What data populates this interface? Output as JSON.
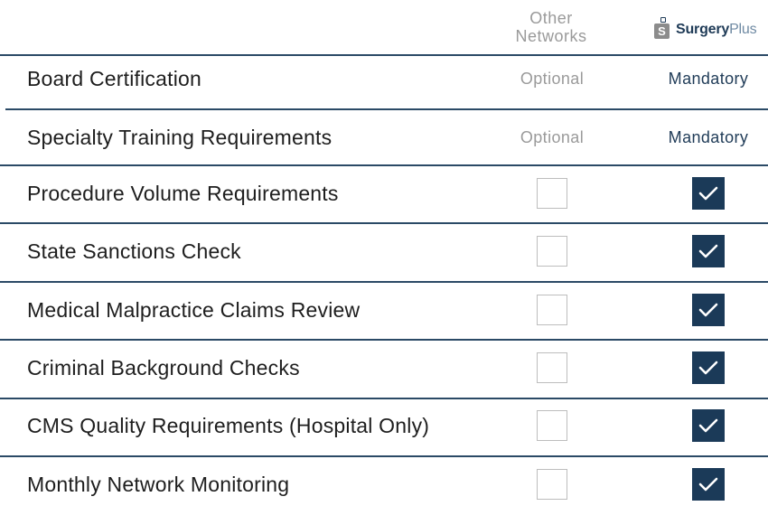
{
  "header": {
    "other_networks_line1": "Other",
    "other_networks_line2": "Networks",
    "brand_name": "Surgery",
    "brand_suffix": "Plus",
    "brand_icon_letter": "S"
  },
  "rows": [
    {
      "label": "Board Certification",
      "other": "Optional",
      "surgeryplus": "Mandatory"
    },
    {
      "label": "Specialty Training Requirements",
      "other": "Optional",
      "surgeryplus": "Mandatory"
    },
    {
      "label": "Procedure Volume Requirements",
      "other_checked": false,
      "surgeryplus_checked": true
    },
    {
      "label": "State Sanctions Check",
      "other_checked": false,
      "surgeryplus_checked": true
    },
    {
      "label": "Medical Malpractice Claims Review",
      "other_checked": false,
      "surgeryplus_checked": true
    },
    {
      "label": "Criminal Background Checks",
      "other_checked": false,
      "surgeryplus_checked": true
    },
    {
      "label": "CMS Quality Requirements (Hospital Only)",
      "other_checked": false,
      "surgeryplus_checked": true
    },
    {
      "label": "Monthly Network Monitoring",
      "other_checked": false,
      "surgeryplus_checked": true
    }
  ],
  "colors": {
    "navy": "#1b3a58",
    "grey_text": "#9a9a9a",
    "divider": "#2b4a66"
  }
}
